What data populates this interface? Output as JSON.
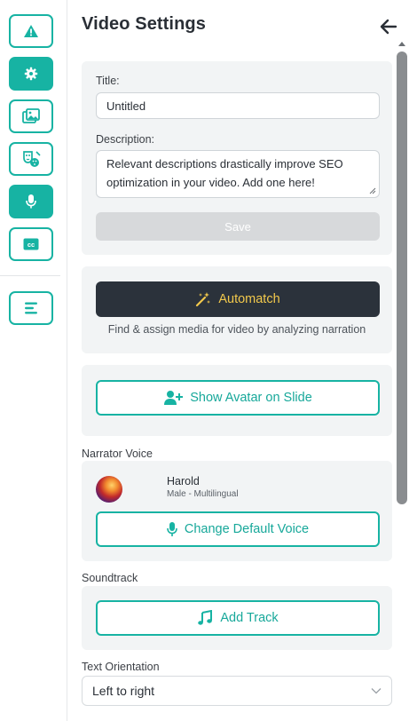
{
  "colors": {
    "accent": "#17b3a3",
    "dark_button": "#2b323b",
    "automatch_text": "#f2c94c",
    "card_bg": "#f2f4f5",
    "save_disabled": "#d7d9db"
  },
  "sidebar": {
    "items": [
      {
        "icon": "warning-icon",
        "active": false
      },
      {
        "icon": "gear-icon",
        "active": true
      },
      {
        "icon": "media-gallery-icon",
        "active": false
      },
      {
        "icon": "avatar-palette-icon",
        "active": false
      },
      {
        "icon": "microphone-icon",
        "active": true
      },
      {
        "icon": "closed-captions-icon",
        "active": false
      },
      {
        "icon": "menu-lines-icon",
        "active": false
      }
    ],
    "cc_text": "cc"
  },
  "header": {
    "title": "Video Settings",
    "back_icon": "arrow-left-icon"
  },
  "details": {
    "title_label": "Title:",
    "title_value": "Untitled",
    "description_label": "Description:",
    "description_value": "Relevant descriptions drastically improve SEO optimization in your video. Add one here!",
    "save_label": "Save"
  },
  "automatch": {
    "button_label": "Automatch",
    "icon": "magic-wand-icon",
    "hint": "Find & assign media for video by analyzing narration"
  },
  "avatar": {
    "button_label": "Show Avatar on Slide",
    "icon": "add-user-icon"
  },
  "narrator": {
    "section_label": "Narrator Voice",
    "voice_name": "Harold",
    "voice_desc": "Male - Multilingual",
    "change_label": "Change Default Voice",
    "icon": "microphone-icon"
  },
  "soundtrack": {
    "section_label": "Soundtrack",
    "add_label": "Add Track",
    "icon": "music-note-icon"
  },
  "orientation": {
    "section_label": "Text Orientation",
    "selected": "Left to right"
  }
}
